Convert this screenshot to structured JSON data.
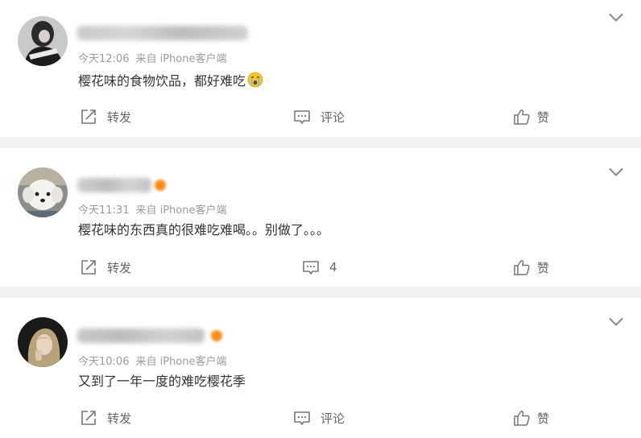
{
  "colors": {
    "accent_badge": "#ff8b1a",
    "meta_text": "#9b9b9b",
    "body_text": "#333333",
    "action_text": "#666666",
    "separator": "#f2f2f2"
  },
  "comments": [
    {
      "avatar_icon": "avatar-girl-dark-photo",
      "time": "今天12:06",
      "source": "来自 iPhone客户端",
      "text": "樱花味的食物饮品，都好难吃",
      "emoji_icon": "crying-face-icon",
      "actions": {
        "share_label": "转发",
        "comment_label": "评论",
        "like_label": "赞"
      }
    },
    {
      "avatar_icon": "avatar-white-dog-photo",
      "time": "今天11:31",
      "source": "来自 iPhone客户端",
      "text": "樱花味的东西真的很难吃难喝。。别做了。。。",
      "actions": {
        "share_label": "转发",
        "comment_label": "4",
        "like_label": "赞"
      }
    },
    {
      "avatar_icon": "avatar-blonde-woman-photo",
      "time": "今天10:06",
      "source": "来自 iPhone客户端",
      "text": "又到了一年一度的难吃樱花季",
      "actions": {
        "share_label": "转发",
        "comment_label": "评论",
        "like_label": "赞"
      }
    }
  ]
}
